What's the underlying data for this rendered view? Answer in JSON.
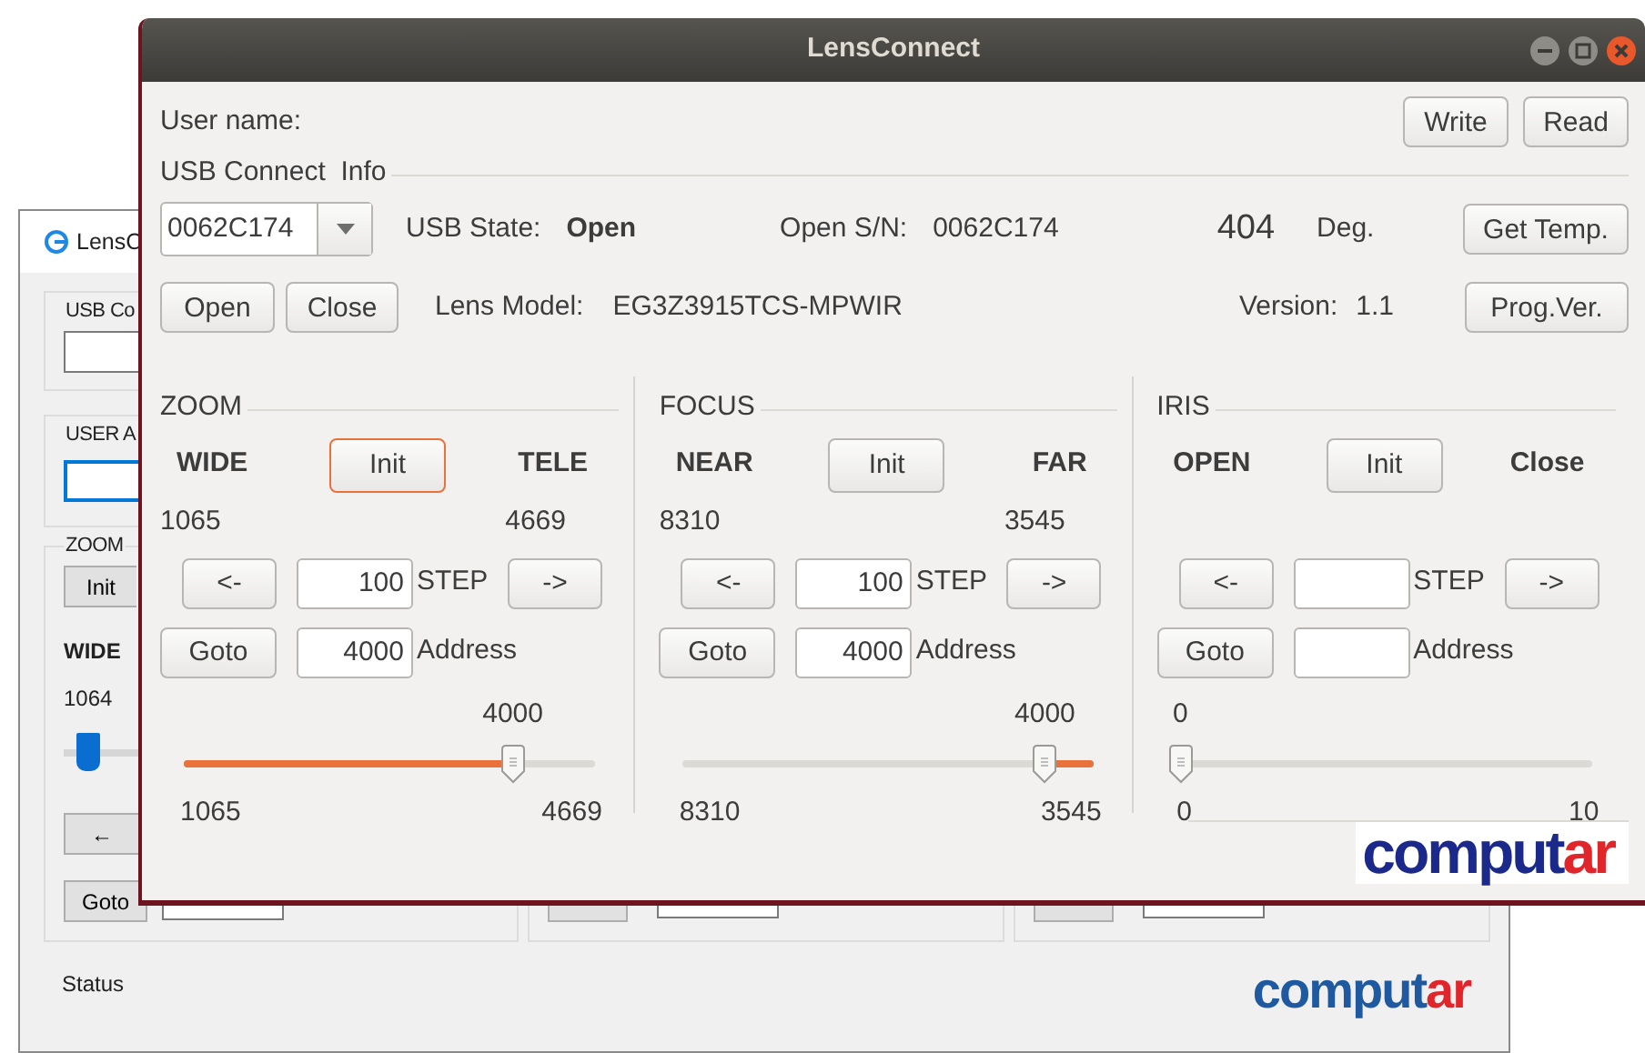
{
  "back_window": {
    "title": "LensC",
    "groups": [
      {
        "label": "USB Co",
        "focused": false
      },
      {
        "label": "USER A",
        "focused": true
      }
    ],
    "zoom": {
      "legend": "ZOOM",
      "init": "Init",
      "left_label": "WIDE",
      "left_value": "1064",
      "step_button": "←",
      "goto": "Goto"
    },
    "status": "Status",
    "logo": {
      "main": "comput",
      "accent": "ar"
    }
  },
  "window": {
    "title": "LensConnect"
  },
  "user": {
    "label": "User name:",
    "buttons": [
      "Write",
      "Read"
    ]
  },
  "usb": {
    "legend": "USB Connect  Info",
    "device": "0062C174",
    "state_label": "USB State:",
    "state": "Open",
    "sn_label": "Open S/N:",
    "sn": "0062C174",
    "temp": "404",
    "temp_unit": "Deg.",
    "temp_button": "Get Temp.",
    "open_button": "Open",
    "close_button": "Close",
    "model_label": "Lens Model:",
    "model": "EG3Z3915TCS-MPWIR",
    "version_label": "Version:",
    "version": "1.1",
    "version_button": "Prog.Ver."
  },
  "axes": [
    {
      "legend": "ZOOM",
      "left_label": "WIDE",
      "init": "Init",
      "init_focused": true,
      "right_label": "TELE",
      "left_value": "1065",
      "right_value": "4669",
      "back": "<-",
      "step": "100",
      "step_label": "STEP",
      "forward": "->",
      "goto": "Goto",
      "address": "4000",
      "address_label": "Address",
      "current": "4000",
      "level": 0.8,
      "reversed": false,
      "min": "1065",
      "max": "4669"
    },
    {
      "legend": "FOCUS",
      "left_label": "NEAR",
      "init": "Init",
      "init_focused": false,
      "right_label": "FAR",
      "left_value": "8310",
      "right_value": "3545",
      "back": "<-",
      "step": "100",
      "step_label": "STEP",
      "forward": "->",
      "goto": "Goto",
      "address": "4000",
      "address_label": "Address",
      "current": "4000",
      "level": 0.12,
      "reversed": true,
      "min": "8310",
      "max": "3545"
    },
    {
      "legend": "IRIS",
      "left_label": "OPEN",
      "init": "Init",
      "init_focused": false,
      "right_label": "Close",
      "back": "<-",
      "step_label": "STEP",
      "forward": "->",
      "goto": "Goto",
      "address_label": "Address",
      "current": "0",
      "level": 0,
      "reversed": false,
      "min": "0",
      "max": "10"
    }
  ],
  "logo": {
    "main": "comput",
    "accent": "ar"
  }
}
